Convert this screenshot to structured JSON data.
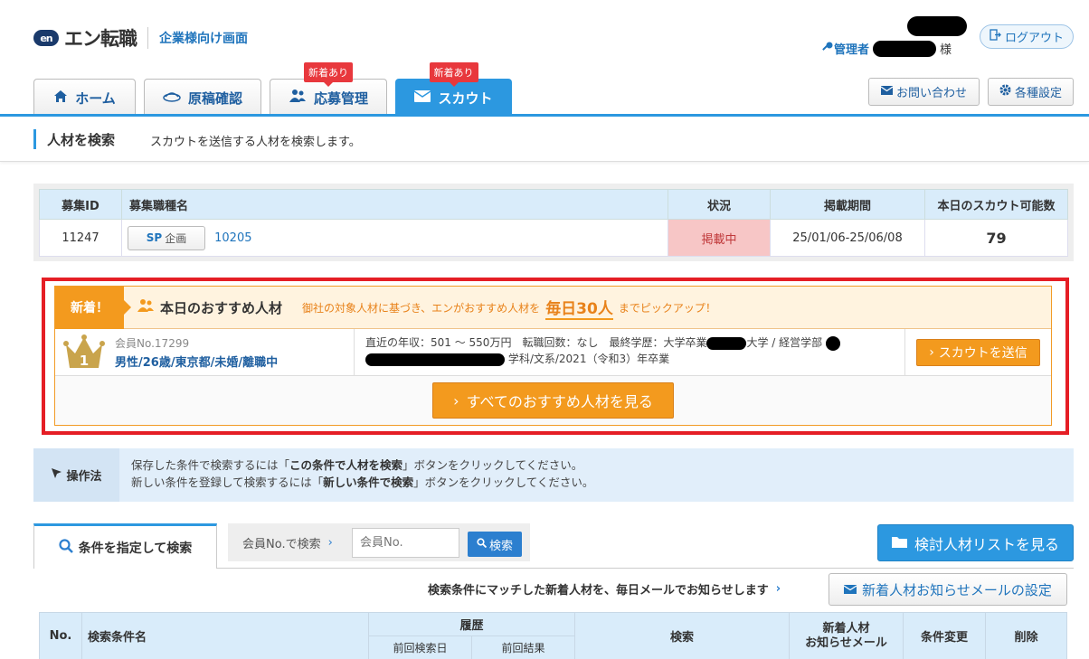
{
  "header": {
    "logo_mark": "en",
    "logo_text": "エン転職",
    "logo_sub": "企業様向け画面",
    "admin_label": "管理者",
    "admin_suffix": "様",
    "logout_label": "ログアウト"
  },
  "tabs": [
    {
      "label": "ホーム",
      "icon": "home-icon",
      "badge": ""
    },
    {
      "label": "原稿確認",
      "icon": "cap-icon",
      "badge": ""
    },
    {
      "label": "応募管理",
      "icon": "users-icon",
      "badge": "新着あり"
    },
    {
      "label": "スカウト",
      "icon": "mail-icon",
      "badge": "新着あり"
    }
  ],
  "header_buttons": {
    "contact": "お問い合わせ",
    "settings": "各種設定"
  },
  "page": {
    "title": "人材を検索",
    "desc": "スカウトを送信する人材を検索します。"
  },
  "job_table": {
    "headers": [
      "募集ID",
      "募集職種名",
      "状況",
      "掲載期間",
      "本日のスカウト可能数"
    ],
    "row": {
      "id": "11247",
      "sp_label": "SP",
      "sp_sub": "企画",
      "name": "10205",
      "status": "掲載中",
      "period": "25/01/06-25/06/08",
      "count": "79"
    }
  },
  "recommend": {
    "new_label": "新着！",
    "title": "本日のおすすめ人材",
    "desc_before": "御社の対象人材に基づき、エンがおすすめ人材を",
    "desc_big": "毎日30人",
    "desc_after": "までピックアップ！",
    "rank": "1",
    "member_no": "会員No.17299",
    "member_attr": "男性/26歳/東京都/未婚/離職中",
    "detail_line1": "直近の年収：501 ～ 550万円　転職回数：なし　最終学歴：大学卒業",
    "detail_univ": "大学 / 経営学部",
    "detail_line2": "学科/文系/2021（令和3）年卒業",
    "scout_btn": "スカウトを送信",
    "see_all_btn": "すべてのおすすめ人材を見る"
  },
  "howto": {
    "label": "操作法",
    "line1_a": "保存した条件で検索するには「",
    "line1_b": "この条件で人材を検索",
    "line1_c": "」ボタンをクリックしてください。",
    "line2_a": "新しい条件を登録して検索するには「",
    "line2_b": "新しい条件で検索",
    "line2_c": "」ボタンをクリックしてください。"
  },
  "search": {
    "tab_label": "条件を指定して検索",
    "member_search_label": "会員No.で検索",
    "member_placeholder": "会員No.",
    "search_btn": "検索",
    "list_btn": "検討人材リストを見る",
    "notify_text": "検索条件にマッチした新着人材を、毎日メールでお知らせします",
    "notify_btn": "新着人材お知らせメールの設定"
  },
  "cond_table": {
    "no": "No.",
    "name": "検索条件名",
    "history": "履歴",
    "last_date": "前回検索日",
    "last_result": "前回結果",
    "search": "検索",
    "notify_1": "新着人材",
    "notify_2": "お知らせメール",
    "change": "条件変更",
    "delete": "削除"
  },
  "colors": {
    "primary": "#2c98e0",
    "accent": "#f39a1e",
    "alert": "#e8383d"
  }
}
